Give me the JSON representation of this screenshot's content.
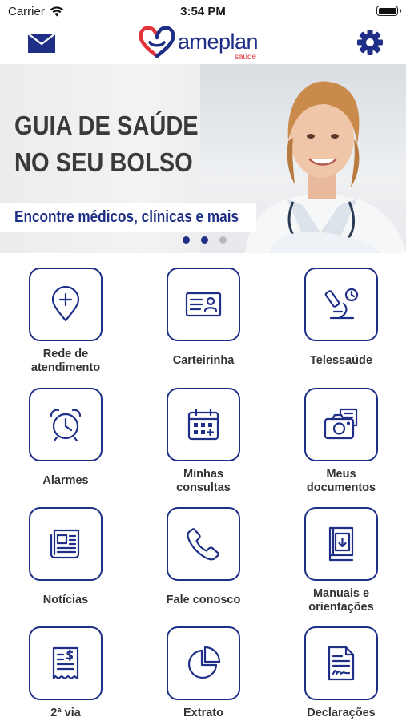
{
  "status_bar": {
    "carrier": "Carrier",
    "time": "3:54 PM"
  },
  "nav": {
    "logo_name": "ameplan",
    "logo_sub": "saúde",
    "mail_icon": "mail-icon",
    "settings_icon": "gear-icon"
  },
  "banner": {
    "headline_line1": "GUIA DE SAÚDE",
    "headline_line2": "NO SEU BOLSO",
    "subtitle": "Encontre médicos, clínicas e mais",
    "page_indicator": {
      "pages": 3,
      "active": 1
    }
  },
  "colors": {
    "brand_blue": "#1f2f88",
    "brand_red": "#e2323a"
  },
  "grid": [
    {
      "label_1": "Rede de",
      "label_2": "atendimento",
      "icon": "location-plus-icon"
    },
    {
      "label_1": "Carteirinha",
      "label_2": "",
      "icon": "id-card-icon"
    },
    {
      "label_1": "Telessaúde",
      "label_2": "",
      "icon": "microscope-clock-icon"
    },
    {
      "label_1": "Alarmes",
      "label_2": "",
      "icon": "alarm-clock-icon"
    },
    {
      "label_1": "Minhas",
      "label_2": "consultas",
      "icon": "calendar-icon"
    },
    {
      "label_1": "Meus",
      "label_2": "documentos",
      "icon": "camera-document-icon"
    },
    {
      "label_1": "Notícias",
      "label_2": "",
      "icon": "newspaper-icon"
    },
    {
      "label_1": "Fale conosco",
      "label_2": "",
      "icon": "phone-icon"
    },
    {
      "label_1": "Manuais e",
      "label_2": "orientações",
      "icon": "manual-download-icon"
    },
    {
      "label_1": "2ª via",
      "label_2": "",
      "icon": "bill-dollar-icon"
    },
    {
      "label_1": "Extrato",
      "label_2": "",
      "icon": "pie-chart-icon"
    },
    {
      "label_1": "Declarações",
      "label_2": "",
      "icon": "signed-document-icon"
    }
  ]
}
